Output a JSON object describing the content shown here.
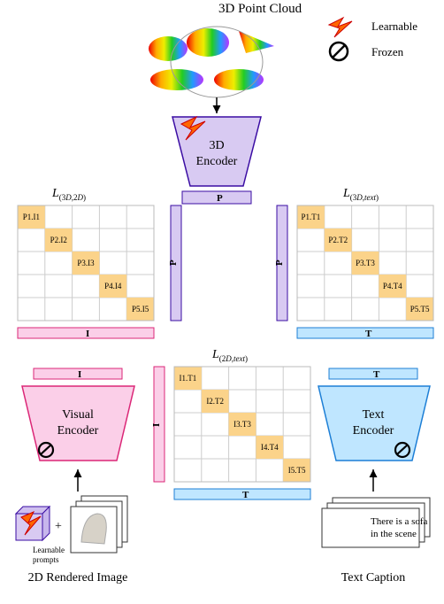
{
  "title_top": "3D Point Cloud",
  "legend": {
    "learnable": "Learnable",
    "frozen": "Frozen"
  },
  "encoders": {
    "three_d": [
      "3D",
      "Encoder"
    ],
    "visual": {
      "line1": "Visual",
      "line2": "Encoder"
    },
    "text": [
      "Text",
      "Encoder"
    ]
  },
  "losses": {
    "l_3d_2d": {
      "prefix": "L",
      "sub_pre": "(3",
      "sub_mid": "D",
      "sub_post": ",2",
      "sub_mid2": "D",
      "sub_end": ")"
    },
    "l_3d_text": {
      "prefix": "L",
      "sub_pre": "(3",
      "sub_mid": "D",
      "sub_post": ",",
      "sub_word": "text",
      "sub_end": ")"
    },
    "l_2d_text": {
      "prefix": "L",
      "sub_pre": "(2",
      "sub_mid": "D",
      "sub_post": ",",
      "sub_word": "text",
      "sub_end": ")"
    }
  },
  "axes": {
    "P": "P",
    "I": "I",
    "T": "T"
  },
  "matrices": {
    "PI": [
      "P1.I1",
      "P2.I2",
      "P3.I3",
      "P4.I4",
      "P5.I5"
    ],
    "PT": [
      "P1.T1",
      "P2.T2",
      "P3.T3",
      "P4.T4",
      "P5.T5"
    ],
    "IT": [
      "I1.T1",
      "I2.T2",
      "I3.T3",
      "I4.T4",
      "I5.T5"
    ]
  },
  "prompts": {
    "label1": "Learnable",
    "label2": "prompts",
    "plus": "+"
  },
  "caption_box": {
    "line1": "There is a sofa",
    "line2": "in the scene"
  },
  "bottom": {
    "left": "2D Rendered Image",
    "right": "Text Caption"
  },
  "chart_data": {
    "type": "diagram",
    "modalities": [
      {
        "name": "3D Point Cloud",
        "encoder": "3D Encoder",
        "learnable": true,
        "output": "P"
      },
      {
        "name": "2D Rendered Image",
        "encoder": "Visual Encoder",
        "learnable": false,
        "has_learnable_prompts": true,
        "output": "I"
      },
      {
        "name": "Text Caption",
        "encoder": "Text Encoder",
        "learnable": false,
        "output": "T"
      }
    ],
    "contrastive_losses": [
      {
        "name": "L_(3D,2D)",
        "rows": "P",
        "cols": "I",
        "grid": "5x5",
        "diagonal": [
          "P1.I1",
          "P2.I2",
          "P3.I3",
          "P4.I4",
          "P5.I5"
        ]
      },
      {
        "name": "L_(3D,text)",
        "rows": "P",
        "cols": "T",
        "grid": "5x5",
        "diagonal": [
          "P1.T1",
          "P2.T2",
          "P3.T3",
          "P4.T4",
          "P5.T5"
        ]
      },
      {
        "name": "L_(2D,text)",
        "rows": "I",
        "cols": "T",
        "grid": "5x5",
        "diagonal": [
          "I1.T1",
          "I2.T2",
          "I3.T3",
          "I4.T4",
          "I5.T5"
        ]
      }
    ],
    "legend": {
      "lightning": "Learnable",
      "no-sign": "Frozen"
    },
    "example_text_caption": "There is a sofa in the scene"
  }
}
